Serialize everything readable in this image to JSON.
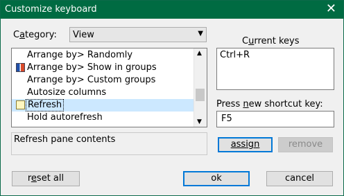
{
  "window": {
    "title": "Customize keyboard",
    "close_glyph": "✕"
  },
  "category": {
    "label_pre": "C",
    "label_ul": "a",
    "label_post": "tegory:",
    "value": "View"
  },
  "commands": [
    {
      "label": "Arrange by> Randomly",
      "icon": ""
    },
    {
      "label": "Arrange by> Show in groups",
      "icon": "show-in-groups-icon"
    },
    {
      "label": "Arrange by> Custom groups",
      "icon": ""
    },
    {
      "label": "Autosize columns",
      "icon": ""
    },
    {
      "label": "Refresh",
      "icon": "refresh-icon",
      "selected": true
    },
    {
      "label": "Hold autorefresh",
      "icon": ""
    }
  ],
  "description": "Refresh pane contents",
  "current_keys": {
    "label_pre": "C",
    "label_ul": "u",
    "label_post": "rrent keys",
    "keys": "Ctrl+R"
  },
  "new_key": {
    "label_pre": "Press ",
    "label_ul": "n",
    "label_post": "ew shortcut key:",
    "value": "F5"
  },
  "buttons": {
    "assign": "assign",
    "remove": "remove",
    "reset_all_pre": "r",
    "reset_all_ul": "e",
    "reset_all_post": "set all",
    "ok": "ok",
    "cancel": "cancel"
  }
}
